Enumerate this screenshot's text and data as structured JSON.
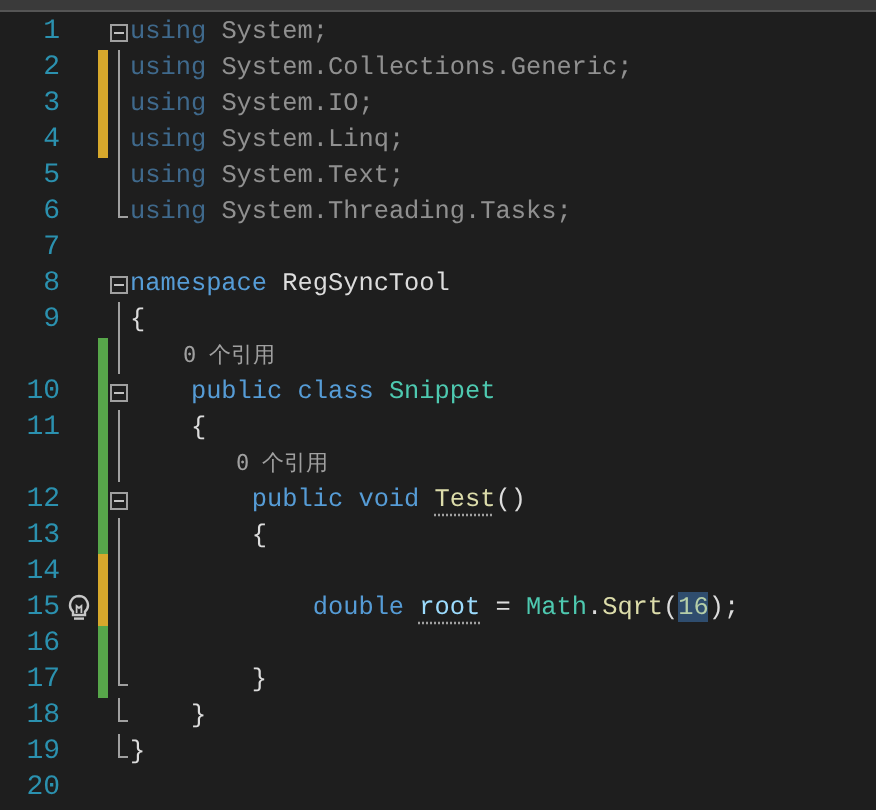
{
  "editor": {
    "rows": [
      {
        "kind": "line",
        "number": "1",
        "modified": false,
        "saved": false,
        "fold_start": true,
        "fold_end": false,
        "lightbulb": false,
        "faded": true,
        "tokens": [
          {
            "text": "using ",
            "kind": "keyword"
          },
          {
            "text": "System;",
            "kind": "plain"
          }
        ]
      },
      {
        "kind": "line",
        "number": "2",
        "modified": true,
        "saved": false,
        "fold_start": false,
        "fold_end": false,
        "lightbulb": false,
        "faded": true,
        "tokens": [
          {
            "text": "using ",
            "kind": "keyword"
          },
          {
            "text": "System.Collections.Generic;",
            "kind": "plain"
          }
        ]
      },
      {
        "kind": "line",
        "number": "3",
        "modified": true,
        "saved": false,
        "fold_start": false,
        "fold_end": false,
        "lightbulb": false,
        "faded": true,
        "tokens": [
          {
            "text": "using ",
            "kind": "keyword"
          },
          {
            "text": "System.IO;",
            "kind": "plain"
          }
        ]
      },
      {
        "kind": "line",
        "number": "4",
        "modified": true,
        "saved": false,
        "fold_start": false,
        "fold_end": false,
        "lightbulb": false,
        "faded": true,
        "tokens": [
          {
            "text": "using ",
            "kind": "keyword"
          },
          {
            "text": "System.Linq;",
            "kind": "plain"
          }
        ]
      },
      {
        "kind": "line",
        "number": "5",
        "modified": false,
        "saved": false,
        "fold_start": false,
        "fold_end": false,
        "lightbulb": false,
        "faded": true,
        "tokens": [
          {
            "text": "using ",
            "kind": "keyword"
          },
          {
            "text": "System.Text;",
            "kind": "plain"
          }
        ]
      },
      {
        "kind": "line",
        "number": "6",
        "modified": false,
        "saved": false,
        "fold_start": false,
        "fold_end": true,
        "lightbulb": false,
        "faded": true,
        "tokens": [
          {
            "text": "using ",
            "kind": "keyword"
          },
          {
            "text": "System.Threading.Tasks;",
            "kind": "plain"
          }
        ]
      },
      {
        "kind": "blank",
        "number": "7"
      },
      {
        "kind": "line",
        "number": "8",
        "modified": false,
        "saved": false,
        "fold_start": true,
        "fold_end": false,
        "lightbulb": false,
        "faded": false,
        "tokens": [
          {
            "text": "namespace ",
            "kind": "keyword"
          },
          {
            "text": "RegSyncTool",
            "kind": "plain"
          }
        ]
      },
      {
        "kind": "line",
        "number": "9",
        "modified": false,
        "saved": false,
        "fold_start": false,
        "fold_end": false,
        "lightbulb": false,
        "faded": false,
        "tokens": [
          {
            "text": "{",
            "kind": "plain"
          }
        ]
      },
      {
        "kind": "codelens",
        "text": "    0 个引用",
        "saved": true
      },
      {
        "kind": "line",
        "number": "10",
        "modified": false,
        "saved": true,
        "fold_start": true,
        "fold_end": false,
        "lightbulb": false,
        "faded": false,
        "tokens": [
          {
            "text": "    public class ",
            "kind": "keyword"
          },
          {
            "text": "Snippet",
            "kind": "type"
          }
        ]
      },
      {
        "kind": "line",
        "number": "11",
        "modified": false,
        "saved": true,
        "fold_start": false,
        "fold_end": false,
        "lightbulb": false,
        "faded": false,
        "tokens": [
          {
            "text": "    {",
            "kind": "plain"
          }
        ]
      },
      {
        "kind": "codelens",
        "text": "        0 个引用",
        "saved": true
      },
      {
        "kind": "line",
        "number": "12",
        "modified": false,
        "saved": true,
        "fold_start": true,
        "fold_end": false,
        "lightbulb": false,
        "faded": false,
        "tokens": [
          {
            "text": "        public void ",
            "kind": "keyword"
          },
          {
            "text": "Test",
            "kind": "method-suggestion"
          },
          {
            "text": "()",
            "kind": "plain"
          }
        ]
      },
      {
        "kind": "line",
        "number": "13",
        "modified": false,
        "saved": true,
        "fold_start": false,
        "fold_end": false,
        "lightbulb": false,
        "faded": false,
        "tokens": [
          {
            "text": "        {",
            "kind": "plain"
          }
        ]
      },
      {
        "kind": "blank",
        "number": "14",
        "modified": true,
        "saved": false
      },
      {
        "kind": "line",
        "number": "15",
        "modified": true,
        "saved": false,
        "fold_start": false,
        "fold_end": false,
        "lightbulb": true,
        "faded": false,
        "tokens": [
          {
            "text": "            double ",
            "kind": "keyword"
          },
          {
            "text": "root",
            "kind": "variable-suggestion"
          },
          {
            "text": " = ",
            "kind": "plain"
          },
          {
            "text": "Math",
            "kind": "type"
          },
          {
            "text": ".",
            "kind": "plain"
          },
          {
            "text": "Sqrt",
            "kind": "method"
          },
          {
            "text": "(",
            "kind": "plain"
          },
          {
            "text": "16",
            "kind": "number-highlighted"
          },
          {
            "text": ");",
            "kind": "plain"
          }
        ]
      },
      {
        "kind": "blank",
        "number": "16",
        "modified": false,
        "saved": true
      },
      {
        "kind": "line",
        "number": "17",
        "modified": false,
        "saved": true,
        "fold_start": false,
        "fold_end": true,
        "lightbulb": false,
        "faded": false,
        "tokens": [
          {
            "text": "        }",
            "kind": "plain"
          }
        ]
      },
      {
        "kind": "line",
        "number": "18",
        "modified": false,
        "saved": false,
        "fold_start": false,
        "fold_end": true,
        "lightbulb": false,
        "faded": false,
        "tokens": [
          {
            "text": "    }",
            "kind": "plain"
          }
        ]
      },
      {
        "kind": "line",
        "number": "19",
        "modified": false,
        "saved": false,
        "fold_start": false,
        "fold_end": true,
        "lightbulb": false,
        "faded": false,
        "tokens": [
          {
            "text": "}",
            "kind": "plain"
          }
        ]
      },
      {
        "kind": "blank",
        "number": "20"
      }
    ]
  }
}
